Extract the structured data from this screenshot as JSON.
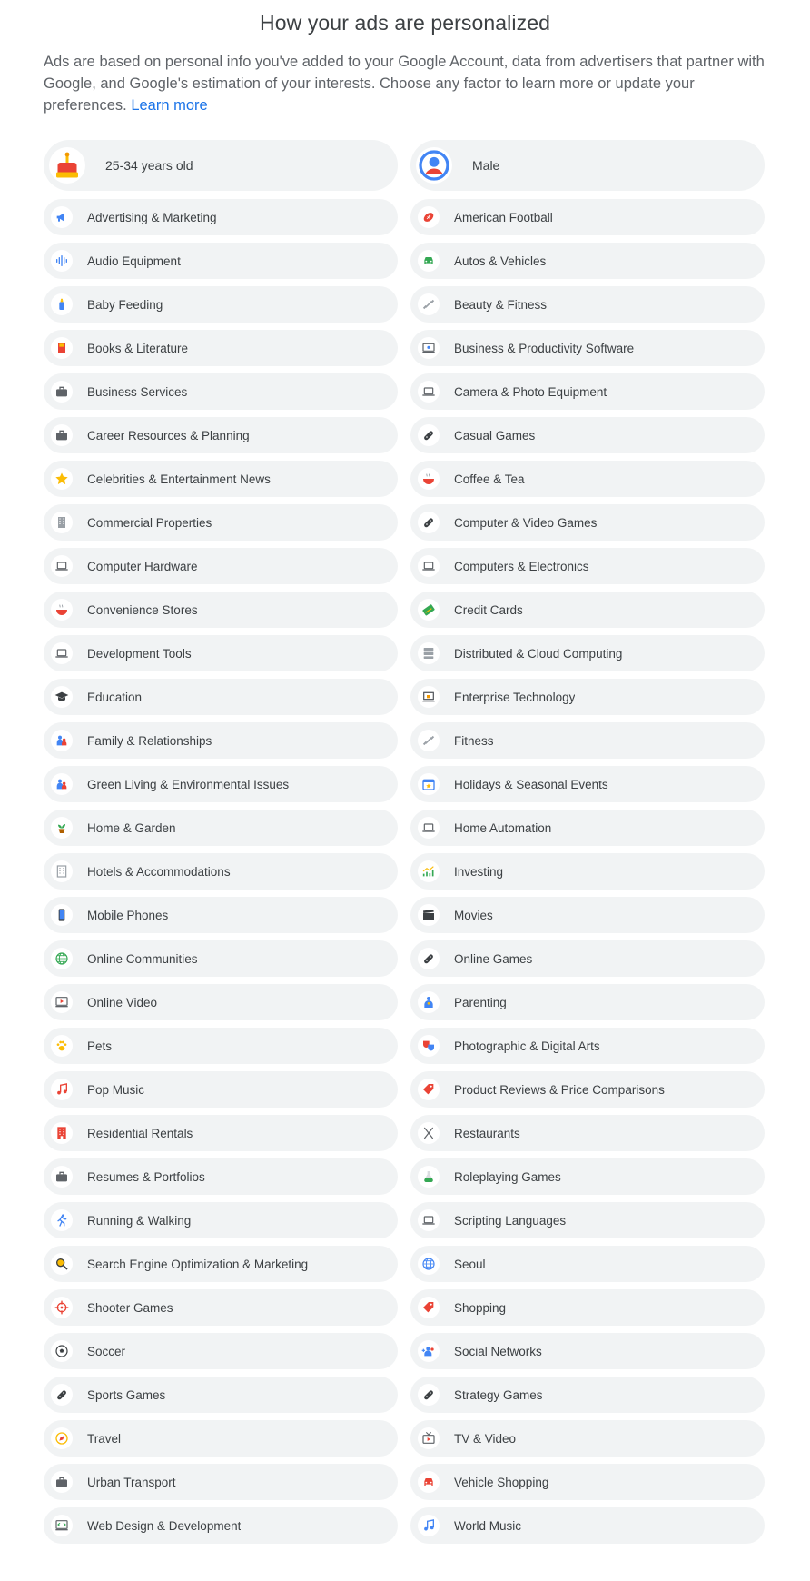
{
  "header": {
    "title": "How your ads are personalized",
    "description": "Ads are based on personal info you've added to your Google Account, data from advertisers that partner with Google, and Google's estimation of your interests. Choose any factor to learn more or update your preferences.",
    "learn_more": "Learn more"
  },
  "factors": [
    {
      "label": "25-34 years old",
      "icon": "cake-icon",
      "color": "#ea4335"
    },
    {
      "label": "Male",
      "icon": "person-icon",
      "color": "#4285f4"
    },
    {
      "label": "Advertising & Marketing",
      "icon": "megaphone-icon",
      "color": "#4285f4"
    },
    {
      "label": "American Football",
      "icon": "football-icon",
      "color": "#ea4335"
    },
    {
      "label": "Audio Equipment",
      "icon": "audio-wave-icon",
      "color": "#4285f4"
    },
    {
      "label": "Autos & Vehicles",
      "icon": "car-icon",
      "color": "#34a853"
    },
    {
      "label": "Baby Feeding",
      "icon": "baby-bottle-icon",
      "color": "#4285f4"
    },
    {
      "label": "Beauty & Fitness",
      "icon": "dumbbell-icon",
      "color": "#9aa0a6"
    },
    {
      "label": "Books & Literature",
      "icon": "book-icon",
      "color": "#ea4335"
    },
    {
      "label": "Business & Productivity Software",
      "icon": "monitor-gear-icon",
      "color": "#5f6368"
    },
    {
      "label": "Business Services",
      "icon": "briefcase-icon",
      "color": "#5f6368"
    },
    {
      "label": "Camera & Photo Equipment",
      "icon": "laptop-icon",
      "color": "#5f6368"
    },
    {
      "label": "Career Resources & Planning",
      "icon": "briefcase-icon",
      "color": "#5f6368"
    },
    {
      "label": "Casual Games",
      "icon": "gamepad-icon",
      "color": "#3c4043"
    },
    {
      "label": "Celebrities & Entertainment News",
      "icon": "star-icon",
      "color": "#fbbc04"
    },
    {
      "label": "Coffee & Tea",
      "icon": "hot-bowl-icon",
      "color": "#ea4335"
    },
    {
      "label": "Commercial Properties",
      "icon": "building-icon",
      "color": "#9aa0a6"
    },
    {
      "label": "Computer & Video Games",
      "icon": "gamepad-icon",
      "color": "#3c4043"
    },
    {
      "label": "Computer Hardware",
      "icon": "laptop-icon",
      "color": "#5f6368"
    },
    {
      "label": "Computers & Electronics",
      "icon": "laptop-icon",
      "color": "#5f6368"
    },
    {
      "label": "Convenience Stores",
      "icon": "hot-bowl-icon",
      "color": "#ea4335"
    },
    {
      "label": "Credit Cards",
      "icon": "credit-card-icon",
      "color": "#34a853"
    },
    {
      "label": "Development Tools",
      "icon": "laptop-icon",
      "color": "#5f6368"
    },
    {
      "label": "Distributed & Cloud Computing",
      "icon": "server-icon",
      "color": "#9aa0a6"
    },
    {
      "label": "Education",
      "icon": "graduation-cap-icon",
      "color": "#3c4043"
    },
    {
      "label": "Enterprise Technology",
      "icon": "monitor-briefcase-icon",
      "color": "#f29900"
    },
    {
      "label": "Family & Relationships",
      "icon": "family-icon",
      "color": "#4285f4"
    },
    {
      "label": "Fitness",
      "icon": "dumbbell-icon",
      "color": "#9aa0a6"
    },
    {
      "label": "Green Living & Environmental Issues",
      "icon": "family-icon",
      "color": "#4285f4"
    },
    {
      "label": "Holidays & Seasonal Events",
      "icon": "calendar-star-icon",
      "color": "#4285f4"
    },
    {
      "label": "Home & Garden",
      "icon": "potted-plant-icon",
      "color": "#34a853"
    },
    {
      "label": "Home Automation",
      "icon": "laptop-icon",
      "color": "#5f6368"
    },
    {
      "label": "Hotels & Accommodations",
      "icon": "hotel-icon",
      "color": "#9aa0a6"
    },
    {
      "label": "Investing",
      "icon": "chart-icon",
      "color": "#34a853"
    },
    {
      "label": "Mobile Phones",
      "icon": "phone-icon",
      "color": "#4285f4"
    },
    {
      "label": "Movies",
      "icon": "clapperboard-icon",
      "color": "#3c4043"
    },
    {
      "label": "Online Communities",
      "icon": "globe-icon",
      "color": "#34a853"
    },
    {
      "label": "Online Games",
      "icon": "gamepad-icon",
      "color": "#3c4043"
    },
    {
      "label": "Online Video",
      "icon": "video-player-icon",
      "color": "#ea4335"
    },
    {
      "label": "Parenting",
      "icon": "parent-child-icon",
      "color": "#4285f4"
    },
    {
      "label": "Pets",
      "icon": "paw-icon",
      "color": "#fbbc04"
    },
    {
      "label": "Photographic & Digital Arts",
      "icon": "theater-masks-icon",
      "color": "#ea4335"
    },
    {
      "label": "Pop Music",
      "icon": "music-note-icon",
      "color": "#ea4335"
    },
    {
      "label": "Product Reviews & Price Comparisons",
      "icon": "price-tag-icon",
      "color": "#ea4335"
    },
    {
      "label": "Residential Rentals",
      "icon": "apartment-icon",
      "color": "#ea4335"
    },
    {
      "label": "Restaurants",
      "icon": "utensils-icon",
      "color": "#5f6368"
    },
    {
      "label": "Resumes & Portfolios",
      "icon": "briefcase-icon",
      "color": "#5f6368"
    },
    {
      "label": "Roleplaying Games",
      "icon": "potion-icon",
      "color": "#34a853"
    },
    {
      "label": "Running & Walking",
      "icon": "runner-icon",
      "color": "#4285f4"
    },
    {
      "label": "Scripting Languages",
      "icon": "laptop-icon",
      "color": "#5f6368"
    },
    {
      "label": "Search Engine Optimization & Marketing",
      "icon": "magnifier-icon",
      "color": "#fbbc04"
    },
    {
      "label": "Seoul",
      "icon": "globe-icon",
      "color": "#4285f4"
    },
    {
      "label": "Shooter Games",
      "icon": "crosshair-icon",
      "color": "#ea4335"
    },
    {
      "label": "Shopping",
      "icon": "price-tag-icon",
      "color": "#ea4335"
    },
    {
      "label": "Soccer",
      "icon": "soccer-ball-icon",
      "color": "#3c4043"
    },
    {
      "label": "Social Networks",
      "icon": "add-people-icon",
      "color": "#4285f4"
    },
    {
      "label": "Sports Games",
      "icon": "gamepad-icon",
      "color": "#3c4043"
    },
    {
      "label": "Strategy Games",
      "icon": "gamepad-icon",
      "color": "#3c4043"
    },
    {
      "label": "Travel",
      "icon": "compass-icon",
      "color": "#fbbc04"
    },
    {
      "label": "TV & Video",
      "icon": "tv-icon",
      "color": "#ea4335"
    },
    {
      "label": "Urban Transport",
      "icon": "briefcase-icon",
      "color": "#5f6368"
    },
    {
      "label": "Vehicle Shopping",
      "icon": "car-icon",
      "color": "#ea4335"
    },
    {
      "label": "Web Design & Development",
      "icon": "code-window-icon",
      "color": "#34a853"
    },
    {
      "label": "World Music",
      "icon": "music-note-icon",
      "color": "#4285f4"
    }
  ]
}
